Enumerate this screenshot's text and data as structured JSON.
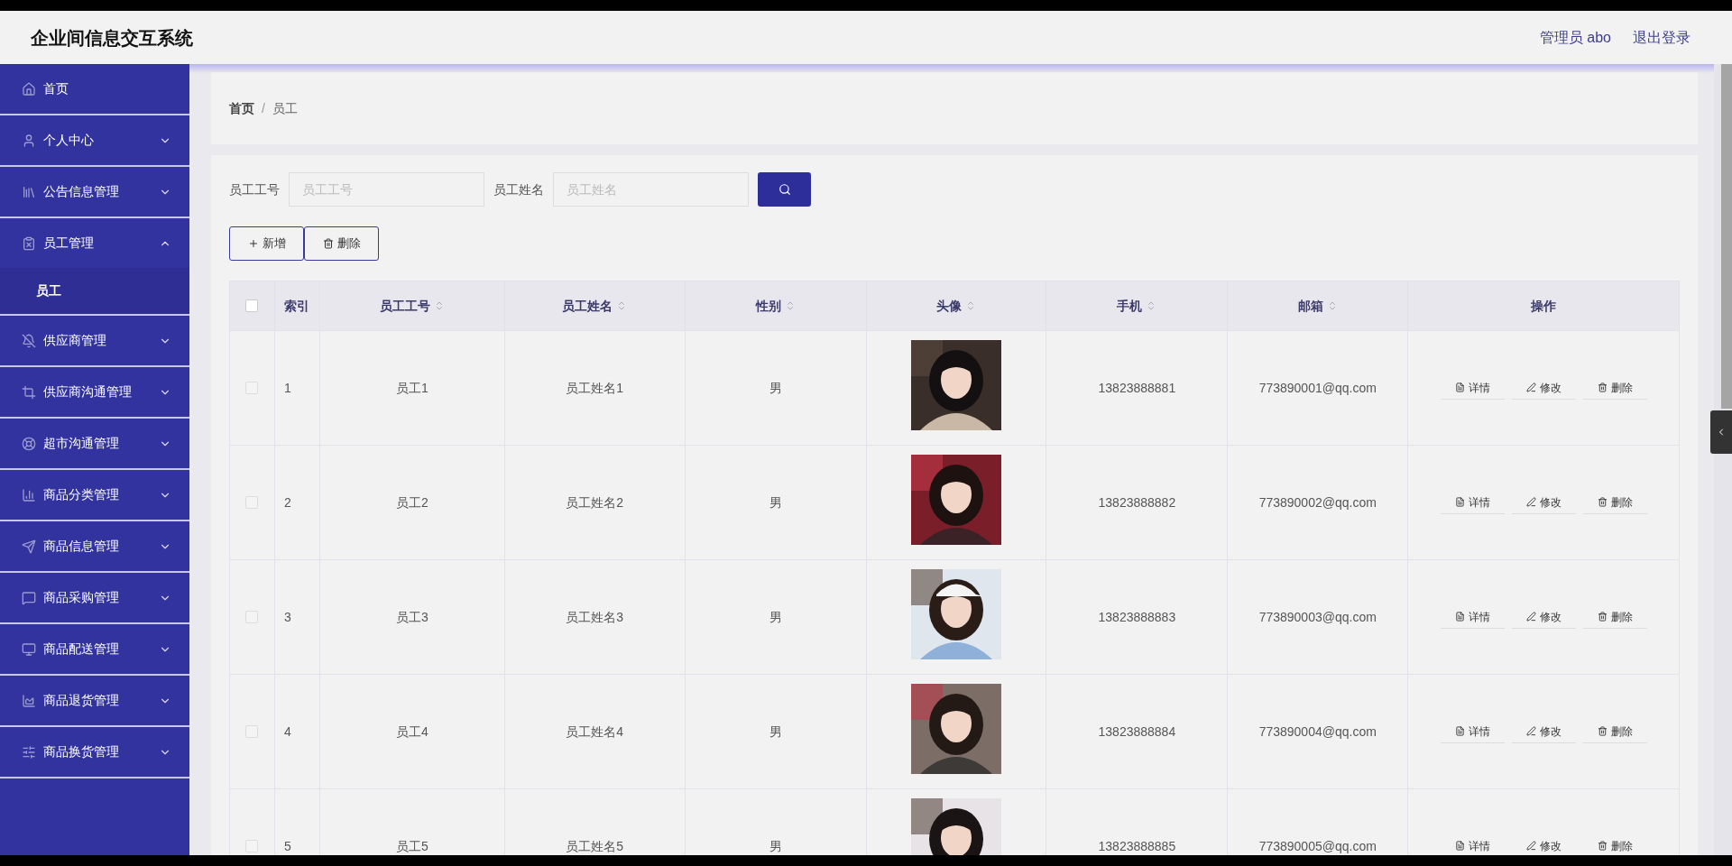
{
  "header": {
    "title": "企业间信息交互系统",
    "user": "管理员 abo",
    "logout": "退出登录"
  },
  "sidebar": {
    "items": [
      {
        "label": "首页",
        "kind": "link"
      },
      {
        "label": "个人中心",
        "kind": "submenu",
        "expanded": false
      },
      {
        "label": "公告信息管理",
        "kind": "submenu",
        "expanded": false
      },
      {
        "label": "员工管理",
        "kind": "submenu",
        "expanded": true,
        "children": [
          {
            "label": "员工",
            "selected": true
          }
        ]
      },
      {
        "label": "供应商管理",
        "kind": "submenu",
        "expanded": false
      },
      {
        "label": "供应商沟通管理",
        "kind": "submenu",
        "expanded": false
      },
      {
        "label": "超市沟通管理",
        "kind": "submenu",
        "expanded": false
      },
      {
        "label": "商品分类管理",
        "kind": "submenu",
        "expanded": false
      },
      {
        "label": "商品信息管理",
        "kind": "submenu",
        "expanded": false
      },
      {
        "label": "商品采购管理",
        "kind": "submenu",
        "expanded": false
      },
      {
        "label": "商品配送管理",
        "kind": "submenu",
        "expanded": false
      },
      {
        "label": "商品退货管理",
        "kind": "submenu",
        "expanded": false
      },
      {
        "label": "商品换货管理",
        "kind": "submenu",
        "expanded": false
      }
    ]
  },
  "breadcrumb": [
    "首页",
    "员工"
  ],
  "breadcrumb_separator": "/",
  "search": {
    "fields": [
      {
        "label": "员工工号",
        "placeholder": "员工工号"
      },
      {
        "label": "员工姓名",
        "placeholder": "员工姓名"
      }
    ]
  },
  "actions": [
    {
      "label": "新增",
      "kind": "add"
    },
    {
      "label": "删除",
      "kind": "delete"
    }
  ],
  "table": {
    "select_all": {
      "checked": false
    },
    "columns": [
      {
        "label": "索引",
        "sortable": false
      },
      {
        "label": "员工工号",
        "sortable": true
      },
      {
        "label": "员工姓名",
        "sortable": true
      },
      {
        "label": "性别",
        "sortable": true
      },
      {
        "label": "头像",
        "sortable": true
      },
      {
        "label": "手机",
        "sortable": true
      },
      {
        "label": "邮箱",
        "sortable": true
      },
      {
        "label": "操作",
        "sortable": false
      }
    ],
    "rows": [
      {
        "checked": false,
        "index": "1",
        "id": "员工1",
        "name": "员工姓名1",
        "gender": "男",
        "phone": "13823888881",
        "email": "773890001@qq.com",
        "buttons": [
          {
            "label": "详情",
            "kind": "detail"
          },
          {
            "label": "修改",
            "kind": "edit"
          },
          {
            "label": "删除",
            "kind": "delete"
          }
        ]
      },
      {
        "checked": false,
        "index": "2",
        "id": "员工2",
        "name": "员工姓名2",
        "gender": "男",
        "phone": "13823888882",
        "email": "773890002@qq.com",
        "buttons": [
          {
            "label": "详情",
            "kind": "detail"
          },
          {
            "label": "修改",
            "kind": "edit"
          },
          {
            "label": "删除",
            "kind": "delete"
          }
        ]
      },
      {
        "checked": false,
        "index": "3",
        "id": "员工3",
        "name": "员工姓名3",
        "gender": "男",
        "phone": "13823888883",
        "email": "773890003@qq.com",
        "buttons": [
          {
            "label": "详情",
            "kind": "detail"
          },
          {
            "label": "修改",
            "kind": "edit"
          },
          {
            "label": "删除",
            "kind": "delete"
          }
        ]
      },
      {
        "checked": false,
        "index": "4",
        "id": "员工4",
        "name": "员工姓名4",
        "gender": "男",
        "phone": "13823888884",
        "email": "773890004@qq.com",
        "buttons": [
          {
            "label": "详情",
            "kind": "detail"
          },
          {
            "label": "修改",
            "kind": "edit"
          },
          {
            "label": "删除",
            "kind": "delete"
          }
        ]
      },
      {
        "checked": false,
        "index": "5",
        "id": "员工5",
        "name": "员工姓名5",
        "gender": "男",
        "phone": "13823888885",
        "email": "773890005@qq.com",
        "buttons": [
          {
            "label": "详情",
            "kind": "detail"
          },
          {
            "label": "修改",
            "kind": "edit"
          },
          {
            "label": "删除",
            "kind": "delete"
          }
        ]
      }
    ]
  }
}
